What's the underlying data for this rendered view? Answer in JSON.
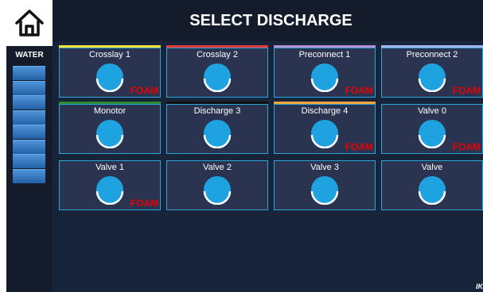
{
  "app": {
    "title": "SELECT DISCHARGE"
  },
  "nav": {
    "home_icon": "home-icon"
  },
  "water": {
    "label": "WATER",
    "level_fraction": 0.875,
    "segments": 8
  },
  "discharges": [
    {
      "label": "Crosslay 1",
      "foam": "FOAM",
      "accent": "#f2e13a"
    },
    {
      "label": "Crosslay 2",
      "foam": "",
      "accent": "#e53a3a"
    },
    {
      "label": "Preconnect 1",
      "foam": "FOAM",
      "accent": "#b88ed0"
    },
    {
      "label": "Preconnect 2",
      "foam": "FOAM",
      "accent": "#a8b4f0"
    },
    {
      "label": "Monotor",
      "foam": "",
      "accent": "#2e8a2e"
    },
    {
      "label": "Discharge 3",
      "foam": "",
      "accent": "#111111"
    },
    {
      "label": "Discharge 4",
      "foam": "FOAM",
      "accent": "#f2a63a"
    },
    {
      "label": "Valve 0",
      "foam": "FOAM",
      "accent": ""
    },
    {
      "label": "Valve 1",
      "foam": "FOAM",
      "accent": ""
    },
    {
      "label": "Valve 2",
      "foam": "",
      "accent": ""
    },
    {
      "label": "Valve 3",
      "foam": "",
      "accent": ""
    },
    {
      "label": "Valve",
      "foam": "",
      "accent": ""
    }
  ],
  "colors": {
    "background": "#141c2c",
    "tile": "#2a3450",
    "tile_border": "#2aa6d8",
    "gauge": "#1ea3e0",
    "foam": "#e60000"
  }
}
